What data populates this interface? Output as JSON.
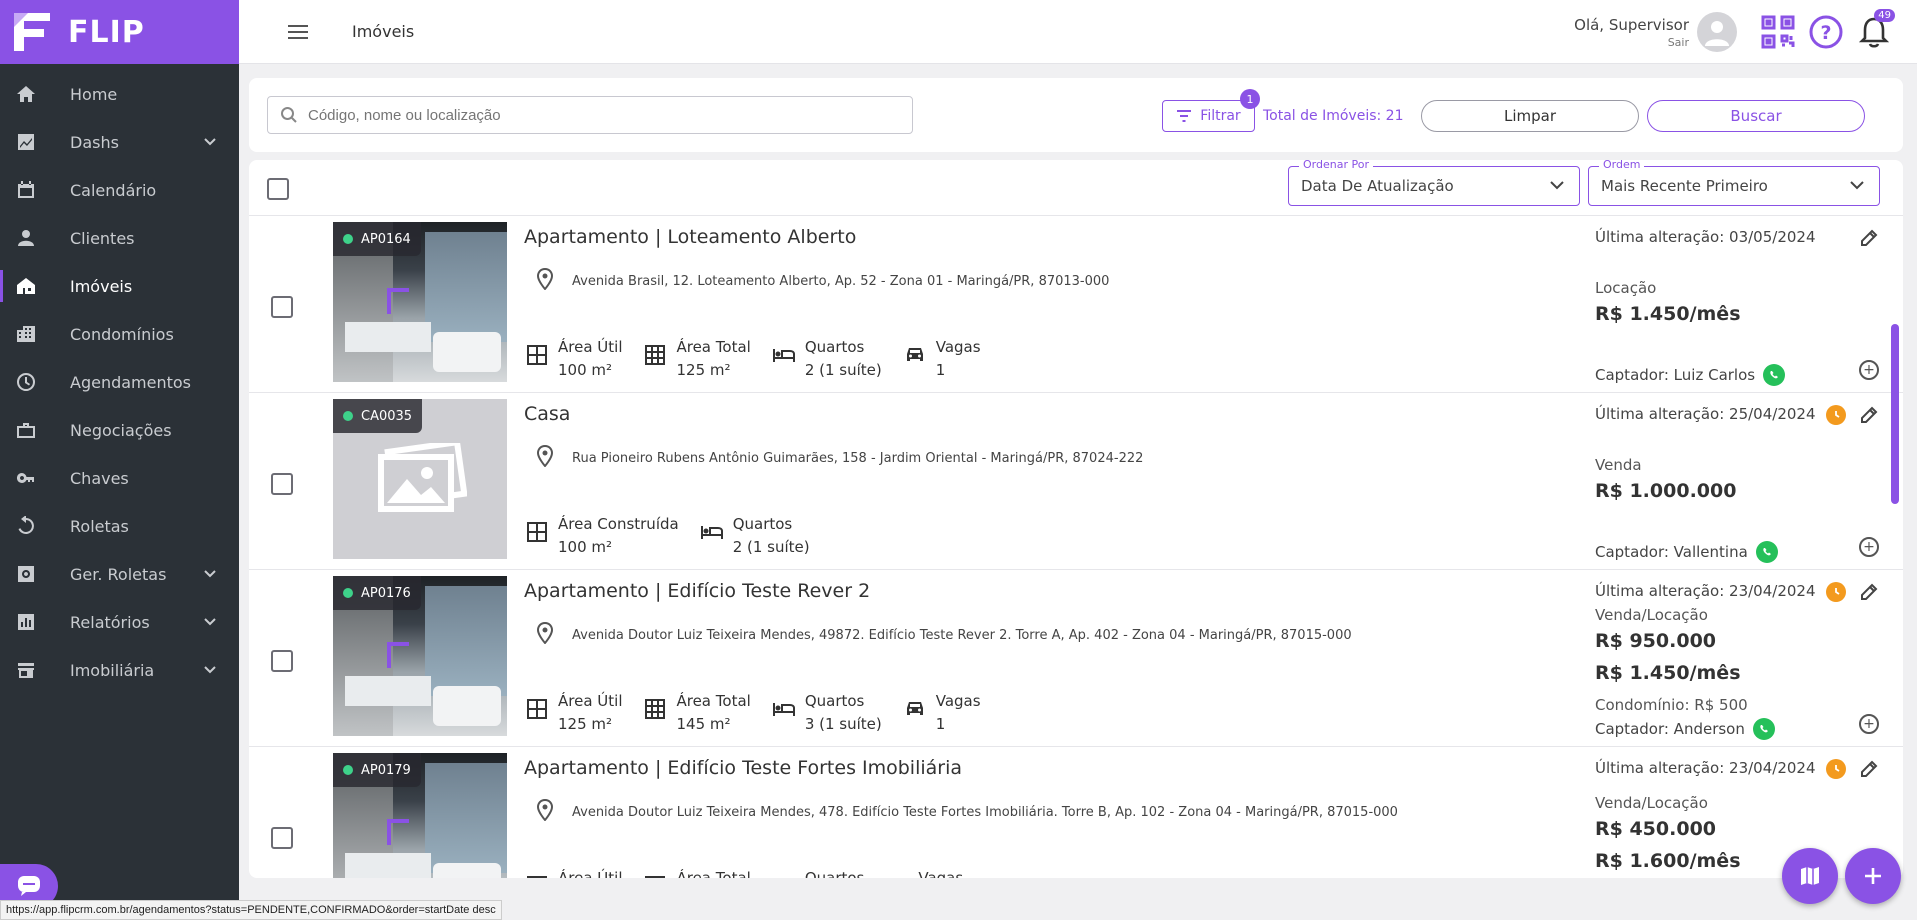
{
  "brand": {
    "name": "FLIP"
  },
  "topbar": {
    "title": "Imóveis",
    "greeting": "Olá, Supervisor",
    "logout": "Sair",
    "notifications_count": "49"
  },
  "sidebar": {
    "items": [
      {
        "label": "Home",
        "icon": "home-icon"
      },
      {
        "label": "Dashs",
        "icon": "chart-icon",
        "expandable": true
      },
      {
        "label": "Calendário",
        "icon": "calendar-icon"
      },
      {
        "label": "Clientes",
        "icon": "person-icon"
      },
      {
        "label": "Imóveis",
        "icon": "house-icon",
        "active": true
      },
      {
        "label": "Condomínios",
        "icon": "building-icon"
      },
      {
        "label": "Agendamentos",
        "icon": "clock-icon"
      },
      {
        "label": "Negociações",
        "icon": "briefcase-icon"
      },
      {
        "label": "Chaves",
        "icon": "key-icon"
      },
      {
        "label": "Roletas",
        "icon": "rotate-icon"
      },
      {
        "label": "Ger. Roletas",
        "icon": "settings-icon",
        "expandable": true
      },
      {
        "label": "Relatórios",
        "icon": "report-icon",
        "expandable": true
      },
      {
        "label": "Imobiliária",
        "icon": "store-icon",
        "expandable": true
      }
    ]
  },
  "search": {
    "placeholder": "Código, nome ou localização",
    "filter_label": "Filtrar",
    "filter_count": "1",
    "total_label": "Total de Imóveis: 21",
    "clear_label": "Limpar",
    "search_label": "Buscar"
  },
  "sort": {
    "order_by_label": "Ordenar Por",
    "order_by_value": "Data De Atualização",
    "order_label": "Ordem",
    "order_value": "Mais Recente Primeiro"
  },
  "properties": [
    {
      "code": "AP0164",
      "title": "Apartamento | Loteamento Alberto",
      "address": "Avenida Brasil, 12. Loteamento Alberto, Ap. 52 - Zona 01 - Maringá/PR, 87013-000",
      "features": [
        {
          "icon": "area-icon",
          "label": "Área Útil",
          "value": "100 m²"
        },
        {
          "icon": "grid-icon",
          "label": "Área Total",
          "value": "125 m²"
        },
        {
          "icon": "bed-icon",
          "label": "Quartos",
          "value": "2 (1 suíte)"
        },
        {
          "icon": "car-icon",
          "label": "Vagas",
          "value": "1"
        }
      ],
      "updated": "Última alteração: 03/05/2024",
      "kind": "Locação",
      "prices": [
        "R$ 1.450/mês"
      ],
      "condo": "",
      "captador": "Captador:  Luiz Carlos",
      "has_photo": true,
      "clock": false
    },
    {
      "code": "CA0035",
      "title": "Casa",
      "address": "Rua Pioneiro Rubens Antônio Guimarães, 158 - Jardim Oriental - Maringá/PR, 87024-222",
      "features": [
        {
          "icon": "area-icon",
          "label": "Área Construída",
          "value": "100 m²"
        },
        {
          "icon": "bed-icon",
          "label": "Quartos",
          "value": "2 (1 suíte)"
        }
      ],
      "updated": "Última alteração: 25/04/2024",
      "kind": "Venda",
      "prices": [
        "R$ 1.000.000"
      ],
      "condo": "",
      "captador": "Captador:  Vallentina",
      "has_photo": false,
      "clock": true
    },
    {
      "code": "AP0176",
      "title": "Apartamento | Edifício Teste Rever 2",
      "address": "Avenida Doutor Luiz Teixeira Mendes, 49872. Edifício Teste Rever 2. Torre A, Ap. 402 - Zona 04 - Maringá/PR, 87015-000",
      "features": [
        {
          "icon": "area-icon",
          "label": "Área Útil",
          "value": "125 m²"
        },
        {
          "icon": "grid-icon",
          "label": "Área Total",
          "value": "145 m²"
        },
        {
          "icon": "bed-icon",
          "label": "Quartos",
          "value": "3 (1 suíte)"
        },
        {
          "icon": "car-icon",
          "label": "Vagas",
          "value": "1"
        }
      ],
      "updated": "Última alteração: 23/04/2024",
      "kind": "Venda/Locação",
      "prices": [
        "R$ 950.000",
        "R$ 1.450/mês"
      ],
      "condo": "Condomínio: R$ 500",
      "captador": "Captador:  Anderson",
      "has_photo": true,
      "clock": true
    },
    {
      "code": "AP0179",
      "title": "Apartamento | Edifício Teste Fortes Imobiliária",
      "address": "Avenida Doutor Luiz Teixeira Mendes, 478. Edifício Teste Fortes Imobiliária. Torre B, Ap. 102 - Zona 04 - Maringá/PR, 87015-000",
      "features": [
        {
          "icon": "area-icon",
          "label": "Área Útil",
          "value": ""
        },
        {
          "icon": "grid-icon",
          "label": "Área Total",
          "value": ""
        },
        {
          "icon": "bed-icon",
          "label": "Quartos",
          "value": ""
        },
        {
          "icon": "car-icon",
          "label": "Vagas",
          "value": ""
        }
      ],
      "updated": "Última alteração: 23/04/2024",
      "kind": "Venda/Locação",
      "prices": [
        "R$ 450.000",
        "R$ 1.600/mês"
      ],
      "condo": "",
      "captador": "",
      "has_photo": true,
      "clock": true
    }
  ],
  "status_url": "https://app.flipcrm.com.br/agendamentos?status=PENDENTE,CONFIRMADO&order=startDate desc",
  "colors": {
    "accent": "#8a52e5",
    "sidebar": "#2b3137",
    "whatsapp": "#25c05a",
    "clock": "#f39a1e"
  }
}
